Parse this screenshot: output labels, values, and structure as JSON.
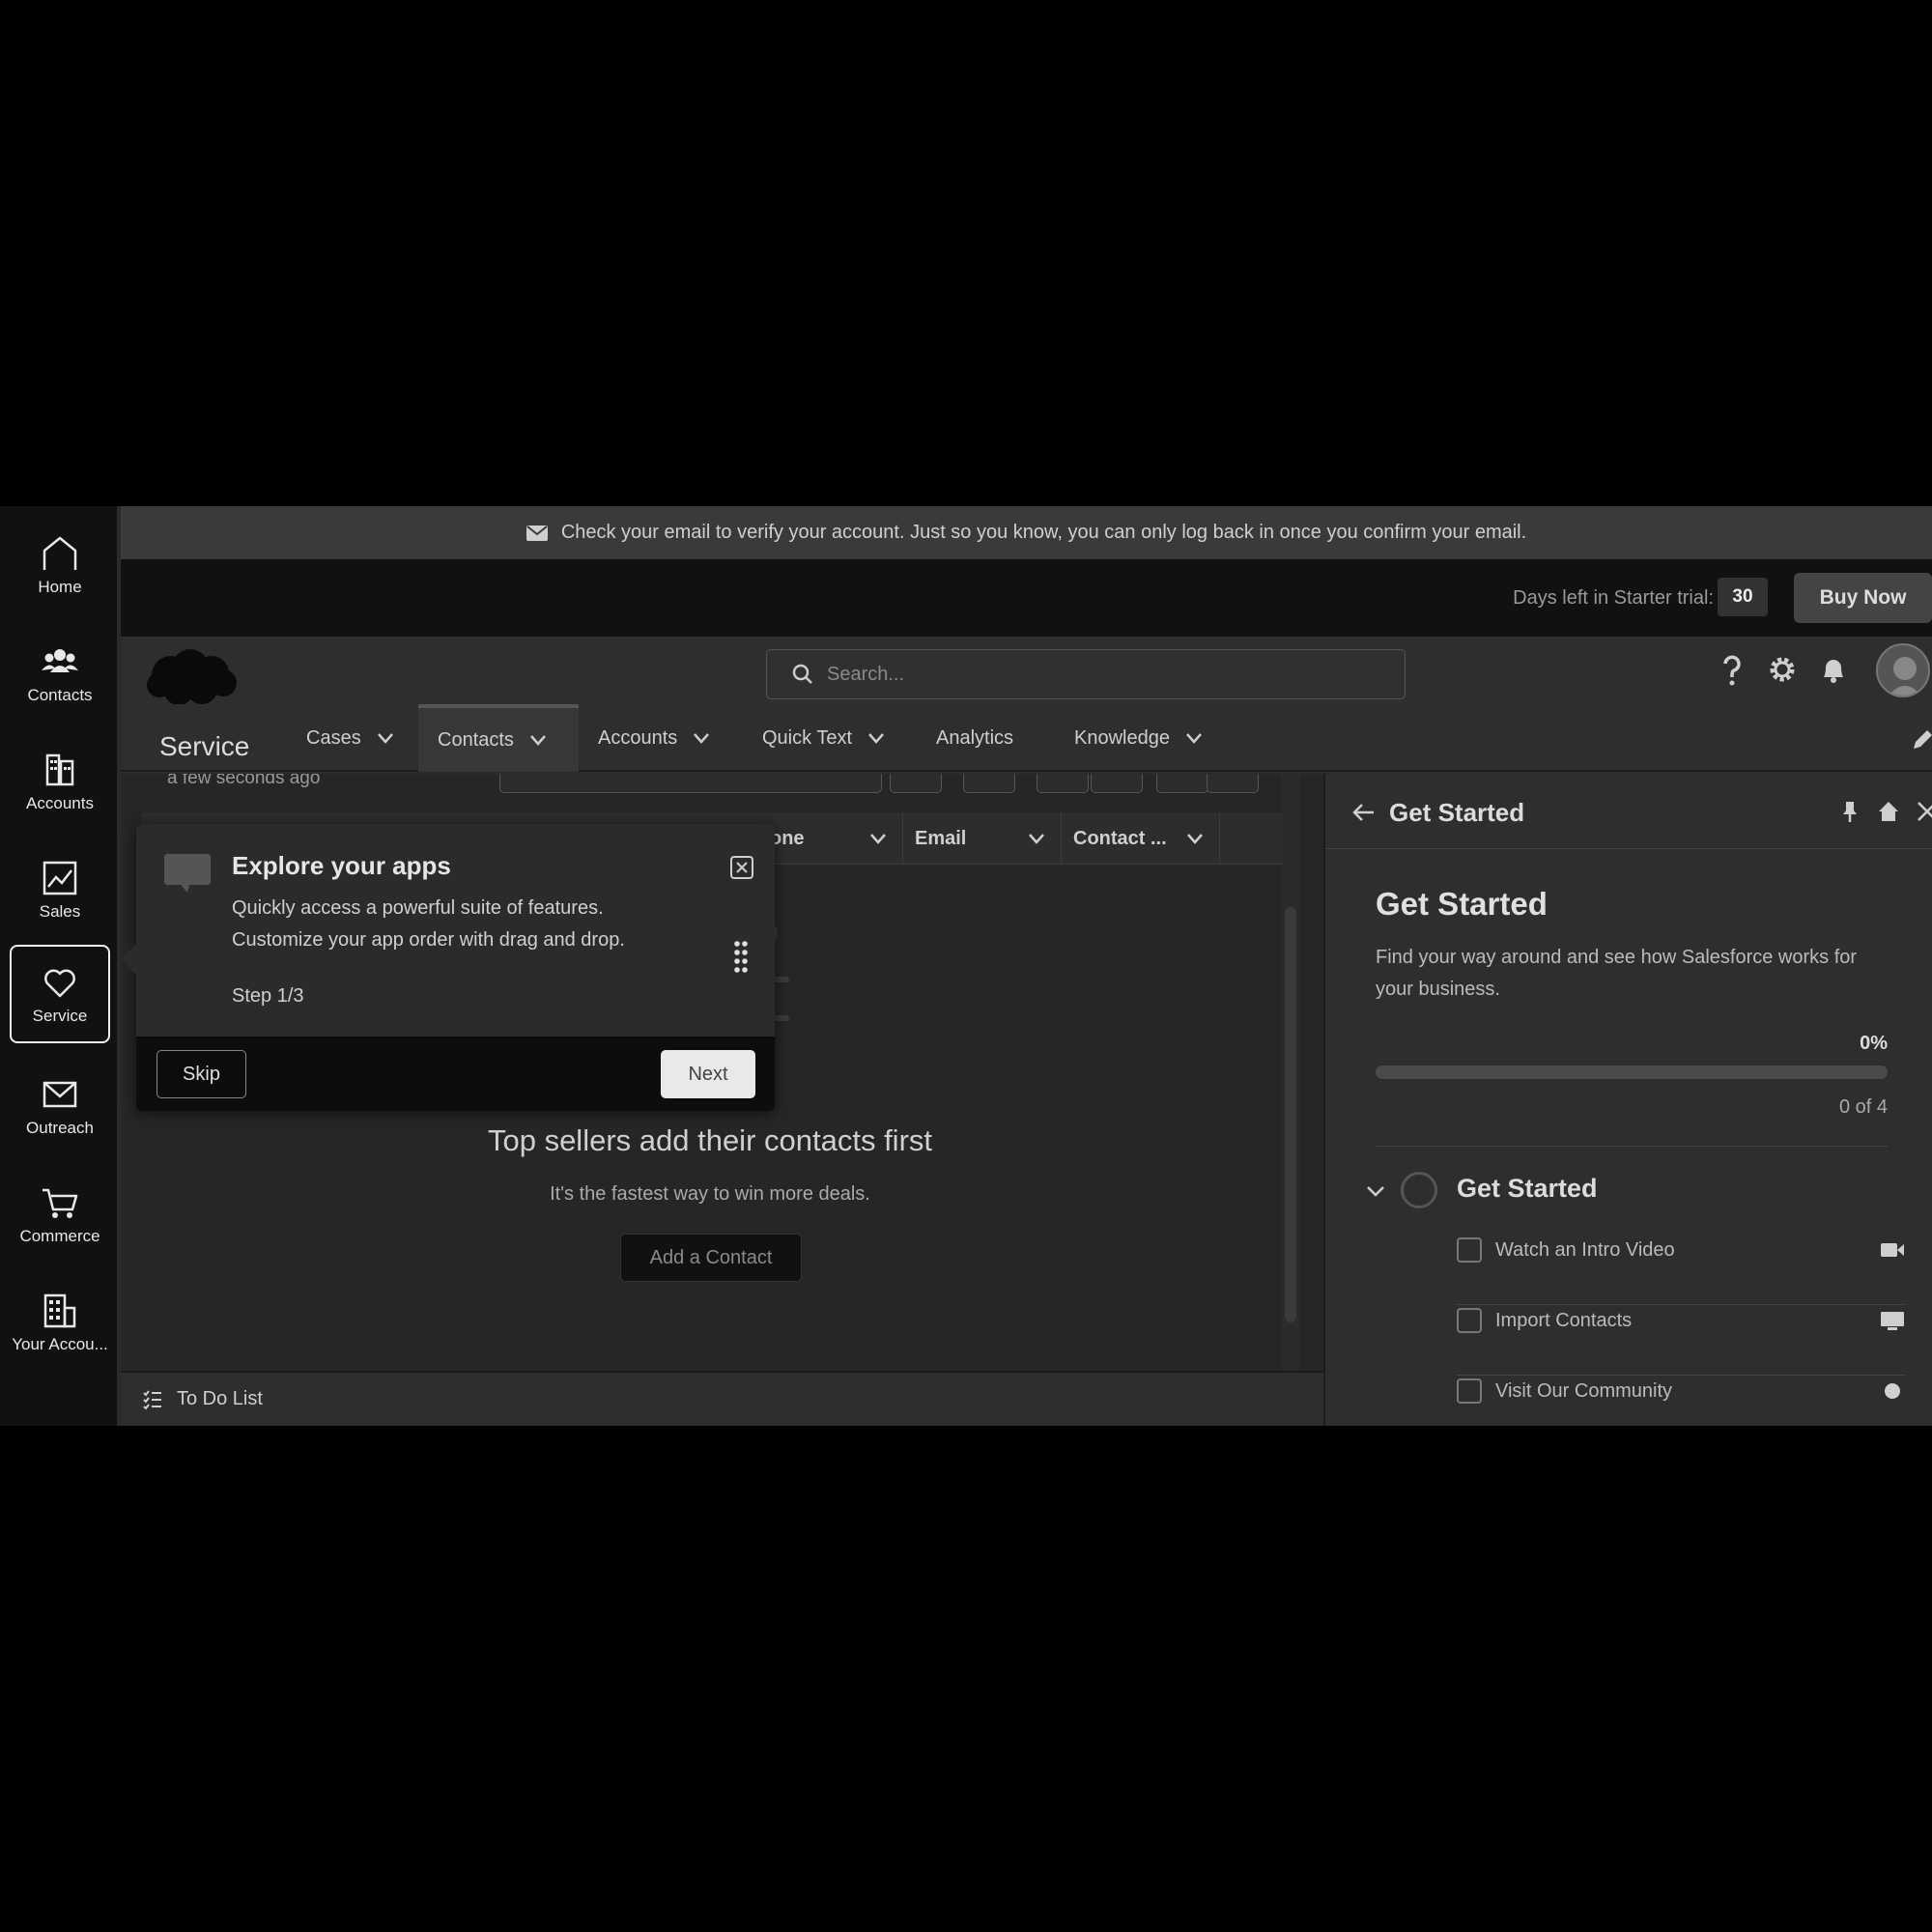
{
  "rail": {
    "items": [
      {
        "label": "Home",
        "icon": "home-icon"
      },
      {
        "label": "Contacts",
        "icon": "contacts-icon"
      },
      {
        "label": "Accounts",
        "icon": "accounts-icon"
      },
      {
        "label": "Sales",
        "icon": "sales-icon"
      },
      {
        "label": "Service",
        "icon": "heart-icon",
        "active": true
      },
      {
        "label": "Outreach",
        "icon": "mail-icon"
      },
      {
        "label": "Commerce",
        "icon": "cart-icon"
      },
      {
        "label": "Your Accou...",
        "icon": "building-icon"
      }
    ]
  },
  "banner": {
    "text": "Check your email to verify your account. Just so you know, you can only log back in once you confirm your email."
  },
  "trial": {
    "label": "Days left in Starter trial:",
    "days": "30",
    "buy_label": "Buy Now"
  },
  "header": {
    "search_placeholder": "Search..."
  },
  "appnav": {
    "app_name": "Service",
    "tabs": [
      {
        "label": "Cases",
        "has_menu": true
      },
      {
        "label": "Contacts",
        "has_menu": true,
        "active": true
      },
      {
        "label": "Accounts",
        "has_menu": true
      },
      {
        "label": "Quick Text",
        "has_menu": true
      },
      {
        "label": "Analytics",
        "has_menu": false
      },
      {
        "label": "Knowledge",
        "has_menu": true
      }
    ]
  },
  "list": {
    "updated": "a few seconds ago",
    "columns": [
      "one",
      "Email",
      "Contact ..."
    ],
    "empty_title": "Top sellers add their contacts first",
    "empty_subtitle": "It's the fastest way to win more deals.",
    "add_button": "Add a Contact"
  },
  "todo": {
    "label": "To Do List"
  },
  "panel": {
    "header_title": "Get Started",
    "title": "Get Started",
    "description": "Find your way around and see how Salesforce works for your business.",
    "progress_label": "0%",
    "progress": 0,
    "count_label": "0 of 4",
    "section_title": "Get Started",
    "tasks": [
      {
        "label": "Watch an Intro Video",
        "icon": "video-icon"
      },
      {
        "label": "Import Contacts",
        "icon": "monitor-icon"
      },
      {
        "label": "Visit Our Community",
        "icon": "external-icon"
      }
    ]
  },
  "coach": {
    "title": "Explore your apps",
    "body1": "Quickly access a powerful suite of features.",
    "body2": "Customize your app order with drag and drop.",
    "step": "Step 1/3",
    "skip_label": "Skip",
    "next_label": "Next"
  },
  "colors": {
    "background": "#000000",
    "rail": "#111111",
    "surface": "#2e2e2e",
    "accent": "#e9e9e9"
  }
}
